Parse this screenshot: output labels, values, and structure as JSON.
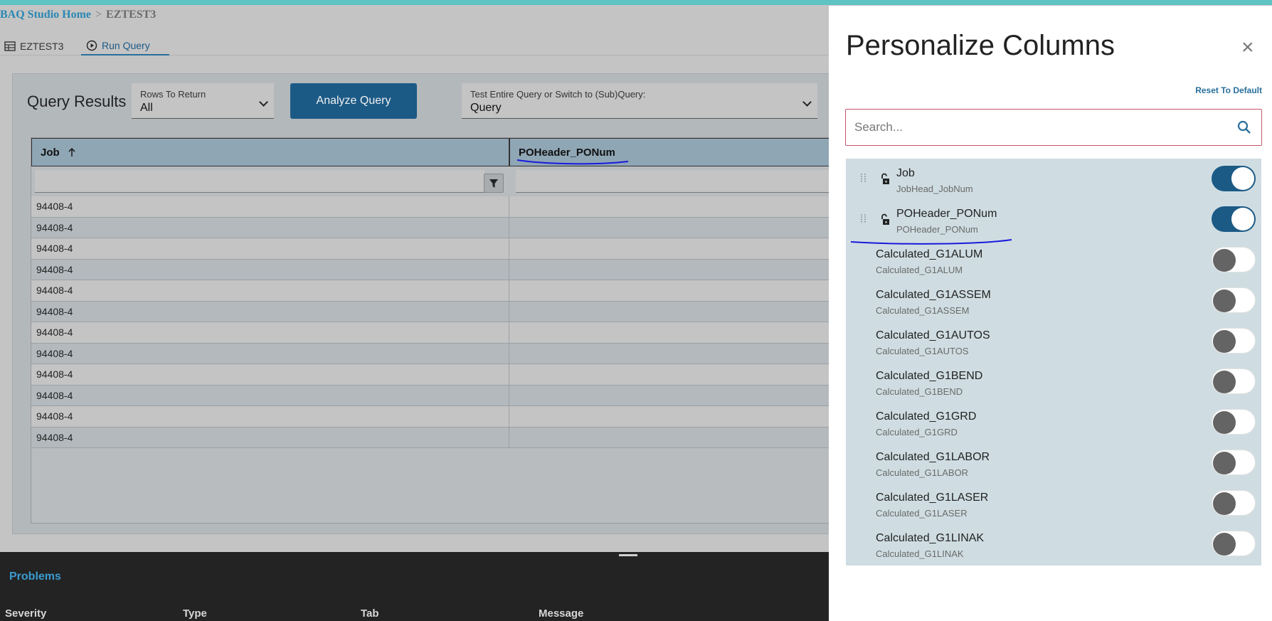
{
  "breadcrumb": {
    "home": "BAQ Studio Home",
    "separator": ">",
    "current": "EZTEST3"
  },
  "tabs": [
    {
      "label": "EZTEST3",
      "icon": "table-icon"
    },
    {
      "label": "Run Query",
      "icon": "play-circle-icon",
      "active": true
    }
  ],
  "query_results": {
    "title": "Query Results",
    "rows_to_return": {
      "label": "Rows To Return",
      "value": "All"
    },
    "analyze_label": "Analyze Query",
    "test_select": {
      "label": "Test Entire Query or Switch to (Sub)Query:",
      "value": "Query"
    },
    "columns": [
      {
        "header": "Job",
        "sort": "ascending"
      },
      {
        "header": "POHeader_PONum"
      }
    ],
    "rows": [
      {
        "job": "94408-4",
        "ponum": ""
      },
      {
        "job": "94408-4",
        "ponum": ""
      },
      {
        "job": "94408-4",
        "ponum": ""
      },
      {
        "job": "94408-4",
        "ponum": ""
      },
      {
        "job": "94408-4",
        "ponum": ""
      },
      {
        "job": "94408-4",
        "ponum": ""
      },
      {
        "job": "94408-4",
        "ponum": ""
      },
      {
        "job": "94408-4",
        "ponum": ""
      },
      {
        "job": "94408-4",
        "ponum": ""
      },
      {
        "job": "94408-4",
        "ponum": ""
      },
      {
        "job": "94408-4",
        "ponum": ""
      },
      {
        "job": "94408-4",
        "ponum": ""
      }
    ]
  },
  "problems": {
    "title": "Problems",
    "columns": [
      "Severity",
      "Type",
      "Tab",
      "Message"
    ]
  },
  "drawer": {
    "title": "Personalize Columns",
    "close": "×",
    "reset_label": "Reset To Default",
    "search_placeholder": "Search...",
    "columns": [
      {
        "name": "Job",
        "field": "JobHead_JobNum",
        "enabled": true,
        "locked": false
      },
      {
        "name": "POHeader_PONum",
        "field": "POHeader_PONum",
        "enabled": true,
        "locked": false
      },
      {
        "name": "Calculated_G1ALUM",
        "field": "Calculated_G1ALUM",
        "enabled": false
      },
      {
        "name": "Calculated_G1ASSEM",
        "field": "Calculated_G1ASSEM",
        "enabled": false
      },
      {
        "name": "Calculated_G1AUTOS",
        "field": "Calculated_G1AUTOS",
        "enabled": false
      },
      {
        "name": "Calculated_G1BEND",
        "field": "Calculated_G1BEND",
        "enabled": false
      },
      {
        "name": "Calculated_G1GRD",
        "field": "Calculated_G1GRD",
        "enabled": false
      },
      {
        "name": "Calculated_G1LABOR",
        "field": "Calculated_G1LABOR",
        "enabled": false
      },
      {
        "name": "Calculated_G1LASER",
        "field": "Calculated_G1LASER",
        "enabled": false
      },
      {
        "name": "Calculated_G1LINAK",
        "field": "Calculated_G1LINAK",
        "enabled": false
      }
    ]
  },
  "colors": {
    "accent": "#1c5a86",
    "link": "#2a88b3",
    "annotation": "#1a1adb"
  }
}
